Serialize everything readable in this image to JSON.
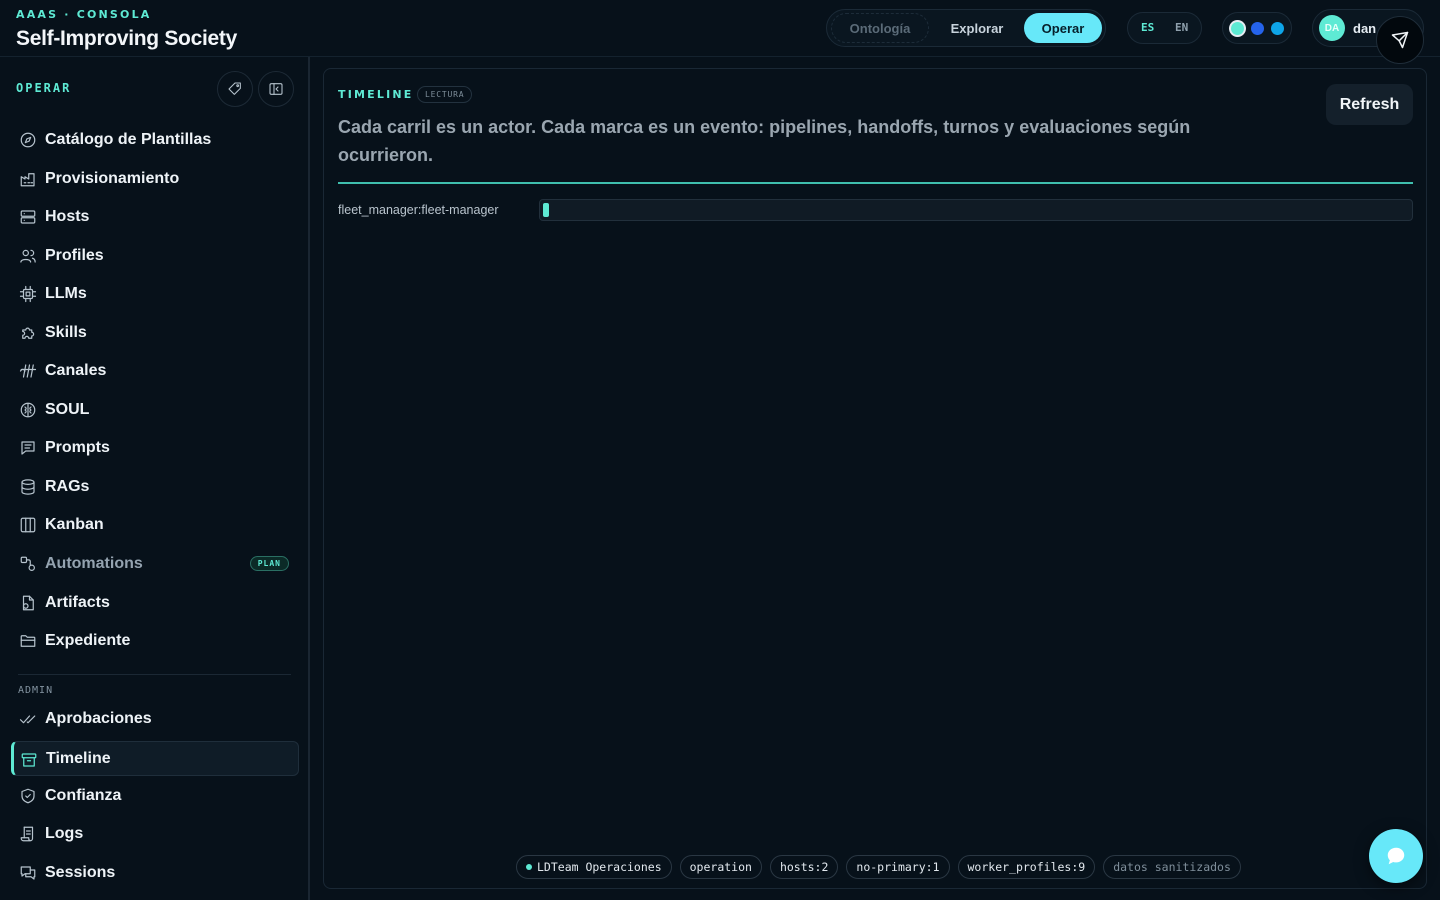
{
  "header": {
    "kicker": "AAAS · CONSOLA",
    "title": "Self-Improving Society",
    "modes": [
      "Ontología",
      "Explorar",
      "Operar"
    ],
    "active_mode": "Operar",
    "languages": [
      "ES",
      "EN"
    ],
    "active_language": "ES",
    "theme_colors": [
      "#5eead4",
      "#2563eb",
      "#0ea5e9"
    ],
    "user": {
      "initials": "DA",
      "name": "dan"
    }
  },
  "sidebar": {
    "heading": "OPERAR",
    "items": [
      {
        "label": "Catálogo de Plantillas",
        "icon": "compass-icon"
      },
      {
        "label": "Provisionamiento",
        "icon": "factory-icon"
      },
      {
        "label": "Hosts",
        "icon": "server-icon"
      },
      {
        "label": "Profiles",
        "icon": "users-icon"
      },
      {
        "label": "LLMs",
        "icon": "cpu-icon"
      },
      {
        "label": "Skills",
        "icon": "puzzle-icon"
      },
      {
        "label": "Canales",
        "icon": "antenna-icon"
      },
      {
        "label": "SOUL",
        "icon": "brain-icon"
      },
      {
        "label": "Prompts",
        "icon": "message-icon"
      },
      {
        "label": "RAGs",
        "icon": "database-icon"
      },
      {
        "label": "Kanban",
        "icon": "columns-icon"
      },
      {
        "label": "Automations",
        "icon": "workflow-icon",
        "badge": "PLAN"
      },
      {
        "label": "Artifacts",
        "icon": "file-icon"
      },
      {
        "label": "Expediente",
        "icon": "folder-icon"
      }
    ],
    "admin_heading": "ADMIN",
    "admin_items": [
      {
        "label": "Aprobaciones",
        "icon": "check-double-icon"
      },
      {
        "label": "Timeline",
        "icon": "archive-icon"
      },
      {
        "label": "Confianza",
        "icon": "shield-icon"
      },
      {
        "label": "Logs",
        "icon": "scroll-icon"
      },
      {
        "label": "Sessions",
        "icon": "chat-icon"
      }
    ],
    "active_item": "Timeline"
  },
  "main": {
    "kicker": "TIMELINE",
    "tag": "LECTURA",
    "description": "Cada carril es un actor. Cada marca es un evento: pipelines, handoffs, turnos y evaluaciones según ocurrieron.",
    "refresh_label": "Refresh",
    "lanes": [
      {
        "label": "fleet_manager:fleet-manager"
      }
    ],
    "footer_chips": [
      "LDTeam Operaciones",
      "operation",
      "hosts:2",
      "no-primary:1",
      "worker_profiles:9",
      "datos sanitizados"
    ]
  }
}
